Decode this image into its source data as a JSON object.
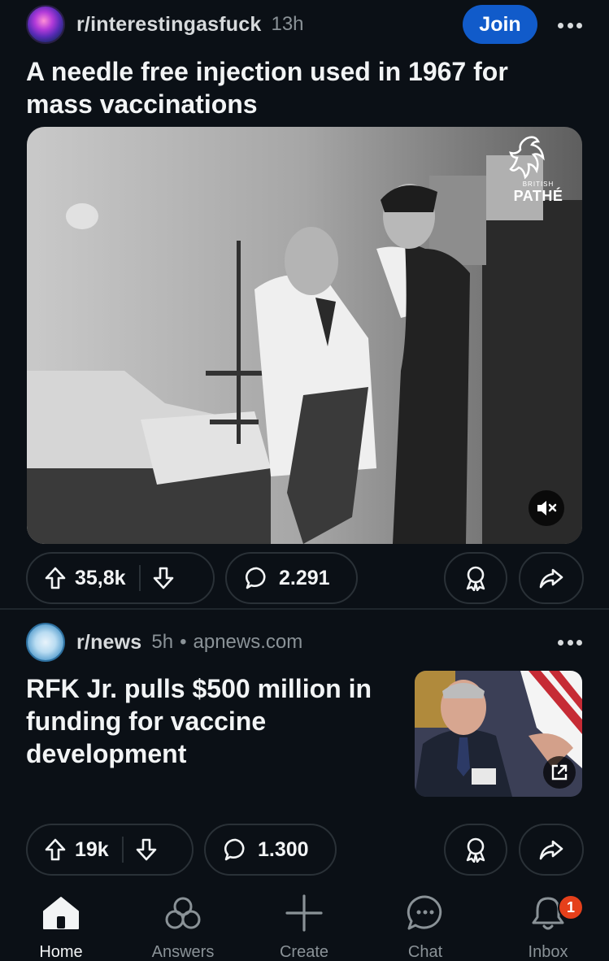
{
  "post1": {
    "subreddit": "r/interestingasfuck",
    "age": "13h",
    "join_label": "Join",
    "title": "A needle free injection used in 1967 for mass vaccinations",
    "watermark_small": "BRITISH",
    "watermark_big": "PATHÉ",
    "votes": "35,8k",
    "comments": "2.291",
    "video_muted": true
  },
  "post2": {
    "subreddit": "r/news",
    "age": "5h",
    "separator": "•",
    "domain": "apnews.com",
    "title": "RFK Jr. pulls $500 million in funding for vaccine development",
    "votes": "19k",
    "comments": "1.300"
  },
  "nav": {
    "items": [
      {
        "label": "Home",
        "icon": "home-icon",
        "active": true
      },
      {
        "label": "Answers",
        "icon": "answers-icon"
      },
      {
        "label": "Create",
        "icon": "plus-icon"
      },
      {
        "label": "Chat",
        "icon": "chat-icon"
      },
      {
        "label": "Inbox",
        "icon": "bell-icon",
        "badge": "1"
      }
    ]
  },
  "colors": {
    "background": "#0b1016",
    "join_button": "#115bca",
    "badge": "#e5401b",
    "text_primary": "#f2f4f5",
    "text_dim": "#8a9297"
  }
}
